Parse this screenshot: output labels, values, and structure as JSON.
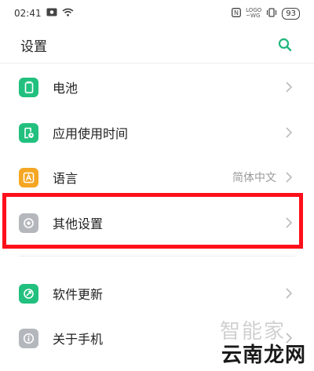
{
  "status_bar": {
    "time": "02:41",
    "right_text": "LOGO\n~WG",
    "battery": "93"
  },
  "header": {
    "title": "设置"
  },
  "colors": {
    "accent": "#1fb57c",
    "icon_green": "#22c07f",
    "icon_orange": "#f5a623",
    "icon_gray": "#b4b8bd",
    "highlight_red": "#ff0f1a"
  },
  "settings": [
    {
      "label": "电池",
      "icon": "battery-icon",
      "value": ""
    },
    {
      "label": "应用使用时间",
      "icon": "app-usage-icon",
      "value": ""
    },
    {
      "label": "语言",
      "icon": "language-icon",
      "value": "简体中文"
    },
    {
      "label": "其他设置",
      "icon": "other-settings-icon",
      "value": ""
    },
    {
      "label": "软件更新",
      "icon": "software-update-icon",
      "value": ""
    },
    {
      "label": "关于手机",
      "icon": "info-icon",
      "value": ""
    }
  ],
  "watermark": {
    "line1": "智能家",
    "line2": "云南龙网"
  }
}
